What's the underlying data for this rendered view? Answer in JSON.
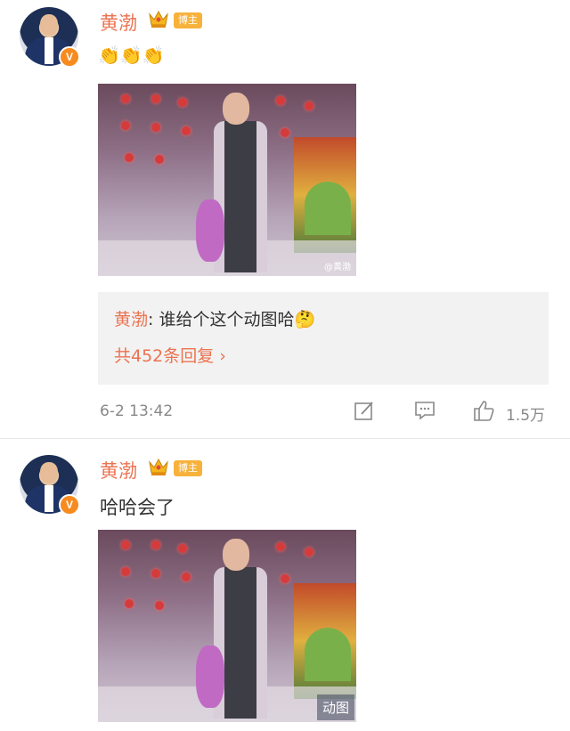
{
  "post1": {
    "author": "黄渤",
    "role_badge": "博主",
    "content_emoji": "👏👏👏",
    "gif_watermark": "@黄渤",
    "reply": {
      "author": "黄渤",
      "separator": ": ",
      "text": "谁给个这个动图哈",
      "emoji": "🤔",
      "count_label": "共452条回复 ›"
    },
    "time": "6-2 13:42",
    "likes": "1.5万"
  },
  "post2": {
    "author": "黄渤",
    "role_badge": "博主",
    "text": "哈哈会了",
    "gif_tag": "动图"
  },
  "icons": [
    "edit-icon",
    "comment-icon",
    "like-icon",
    "crown-icon",
    "verified-v-icon"
  ],
  "colors": {
    "author_name": "#eb7350",
    "role_badge_bg": "#f7b23b",
    "verified_badge": "#f78b1f",
    "reply_bg": "#f2f2f2"
  }
}
